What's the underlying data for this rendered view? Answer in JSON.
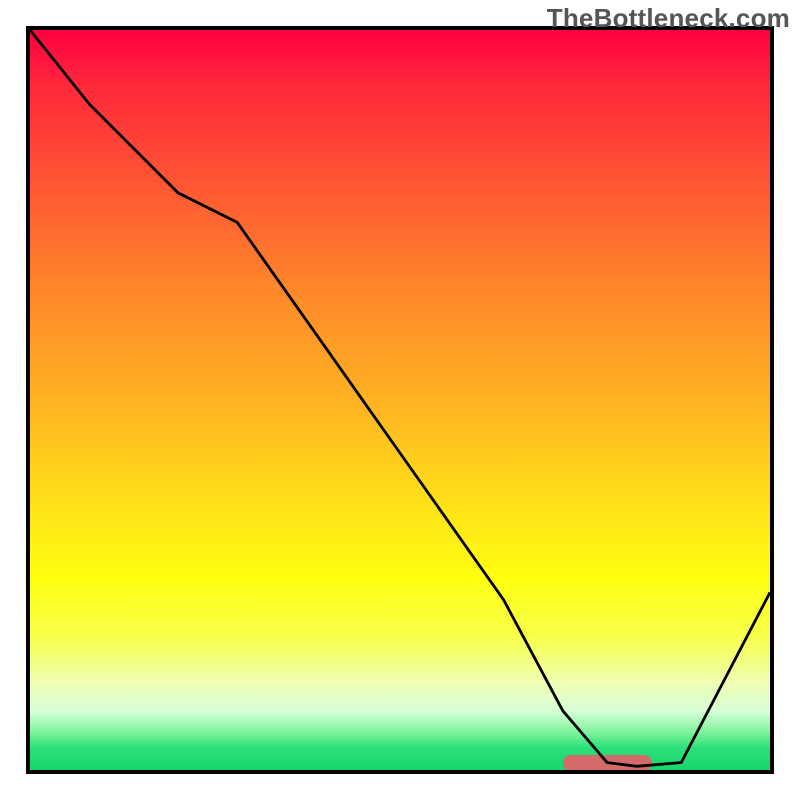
{
  "watermark": "TheBottleneck.com",
  "chart_data": {
    "type": "line",
    "title": "",
    "xlabel": "",
    "ylabel": "",
    "xlim": [
      0,
      100
    ],
    "ylim": [
      0,
      100
    ],
    "x": [
      0,
      8,
      20,
      28,
      40,
      52,
      64,
      72,
      78,
      82,
      88,
      100
    ],
    "values": [
      100,
      90,
      78,
      74,
      57,
      40,
      23,
      8,
      1,
      0.5,
      1,
      24
    ],
    "gradient_stops": [
      {
        "pct": 0,
        "color": "#ff0040"
      },
      {
        "pct": 8,
        "color": "#ff2a3a"
      },
      {
        "pct": 22,
        "color": "#ff5a33"
      },
      {
        "pct": 36,
        "color": "#ff8a2a"
      },
      {
        "pct": 50,
        "color": "#ffb222"
      },
      {
        "pct": 62,
        "color": "#ffda1a"
      },
      {
        "pct": 74,
        "color": "#ffff10"
      },
      {
        "pct": 82,
        "color": "#f7ff4a"
      },
      {
        "pct": 88,
        "color": "#efffb0"
      },
      {
        "pct": 92,
        "color": "#d8ffd8"
      },
      {
        "pct": 95,
        "color": "#7cf29a"
      },
      {
        "pct": 97,
        "color": "#2de07a"
      },
      {
        "pct": 100,
        "color": "#16d66a"
      }
    ],
    "marker": {
      "x_start": 72,
      "x_end": 84,
      "y": 1,
      "color": "#d46a6a"
    }
  }
}
